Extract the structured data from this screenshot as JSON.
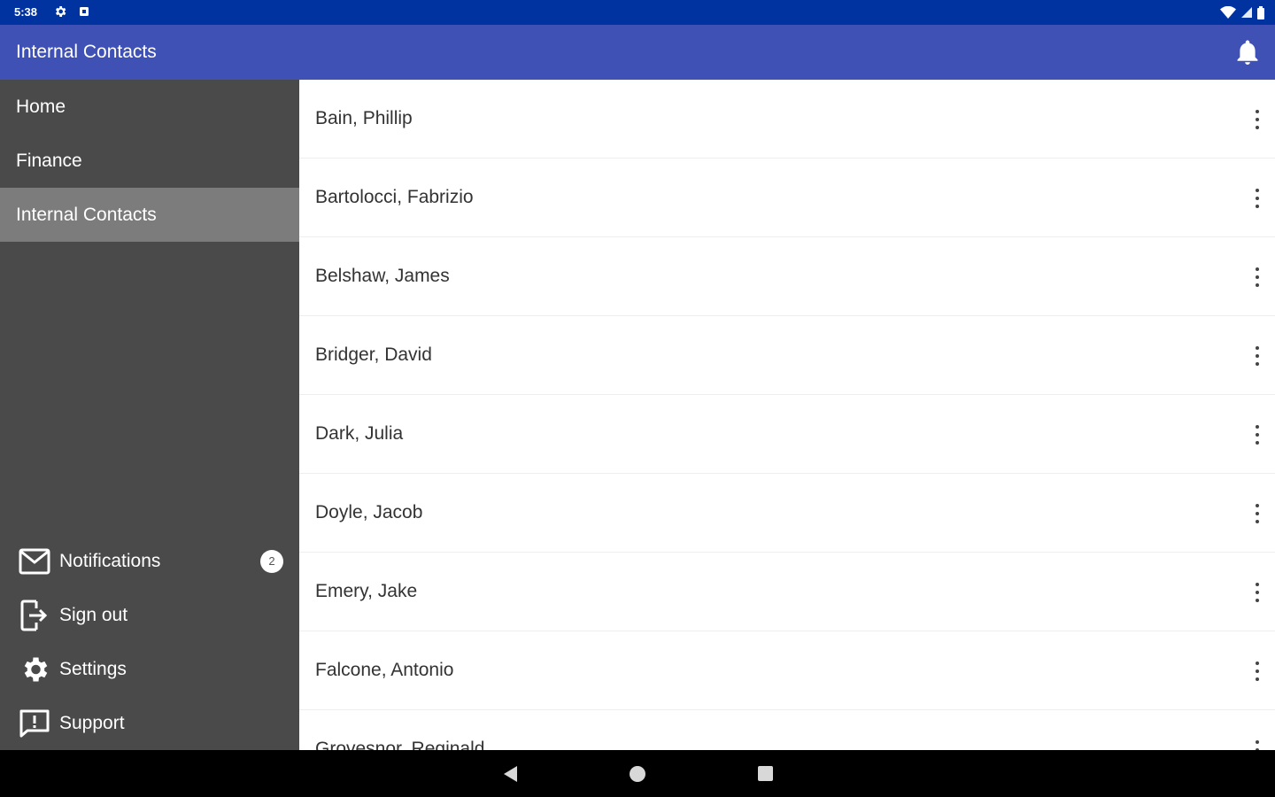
{
  "status_bar": {
    "time": "5:38",
    "icons": [
      "settings-icon",
      "square-icon",
      "wifi-icon",
      "signal-icon",
      "battery-icon"
    ]
  },
  "app_bar": {
    "title": "Internal Contacts",
    "action_icon": "bell-icon"
  },
  "drawer": {
    "nav_items": [
      {
        "label": "Home",
        "active": false
      },
      {
        "label": "Finance",
        "active": false
      },
      {
        "label": "Internal Contacts",
        "active": true
      }
    ],
    "bottom_items": [
      {
        "label": "Notifications",
        "icon": "mail-icon",
        "badge": "2"
      },
      {
        "label": "Sign out",
        "icon": "sign-out-icon"
      },
      {
        "label": "Settings",
        "icon": "gear-icon"
      },
      {
        "label": "Support",
        "icon": "feedback-icon"
      }
    ]
  },
  "contacts": [
    "Bain, Phillip",
    "Bartolocci, Fabrizio",
    "Belshaw, James",
    "Bridger, David",
    "Dark, Julia",
    "Doyle, Jacob",
    "Emery, Jake",
    "Falcone, Antonio",
    "Grovesnor, Reginald"
  ],
  "colors": {
    "status_bar": "#0033a0",
    "app_bar": "#3f51b5",
    "drawer": "#4a4a4a",
    "drawer_active": "#7c7c7c"
  }
}
